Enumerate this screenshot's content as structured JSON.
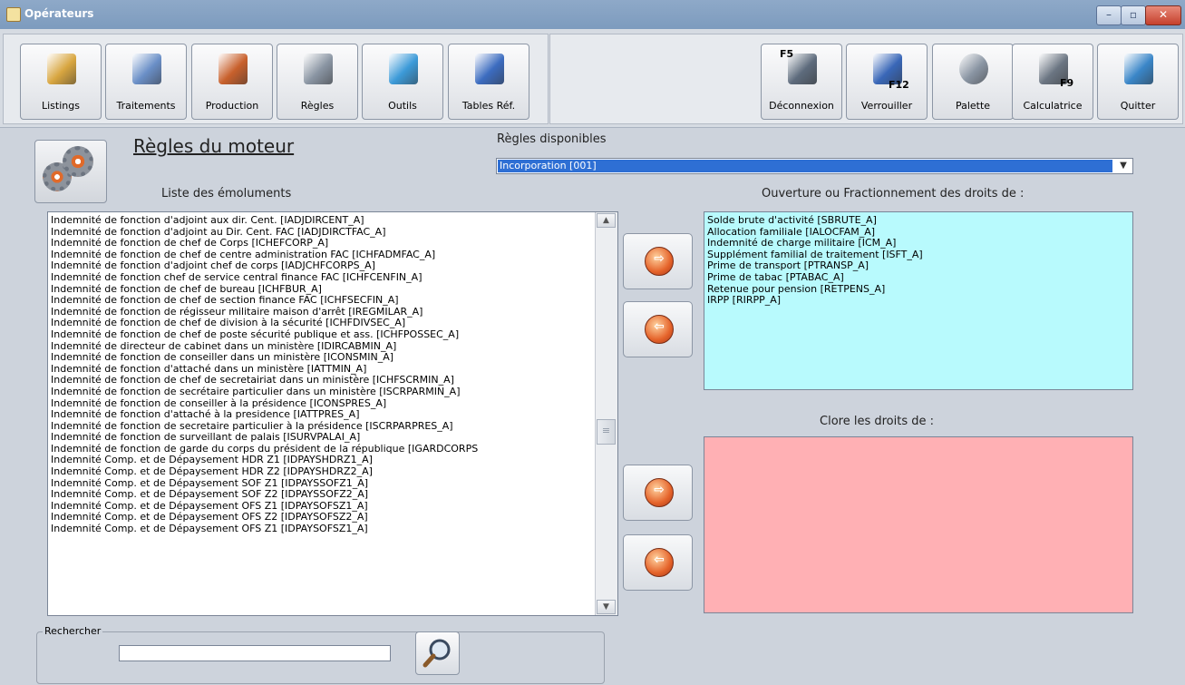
{
  "window": {
    "title": "Opérateurs",
    "controls": [
      "–",
      "▫",
      "✕"
    ]
  },
  "toolbar": {
    "left_buttons": [
      {
        "label": "Listings",
        "icon": "magnifier-report-icon",
        "color": "#d8a640"
      },
      {
        "label": "Traitements",
        "icon": "processing-icon",
        "color": "#6a8fc7"
      },
      {
        "label": "Production",
        "icon": "books-icon",
        "color": "#c8602c"
      },
      {
        "label": "Règles",
        "icon": "gears-icon",
        "color": "#8a95a3"
      },
      {
        "label": "Outils",
        "icon": "toolbox-icon",
        "color": "#3c9ad8"
      },
      {
        "label": "Tables Réf.",
        "icon": "tables-icon",
        "color": "#3c6cc0"
      }
    ],
    "right_buttons": [
      {
        "label": "Déconnexion",
        "icon": "disconnect-icon",
        "key": "F5",
        "color": "#5d6b7c"
      },
      {
        "label": "Verrouiller",
        "icon": "lock-screen-icon",
        "key": "F12",
        "color": "#3967b8"
      },
      {
        "label": "Palette",
        "icon": "palette-icon",
        "key": "",
        "color": "#8a95a3"
      },
      {
        "label": "Calculatrice",
        "icon": "calculator-icon",
        "key": "F9",
        "color": "#6b7582"
      },
      {
        "label": "Quitter",
        "icon": "exit-icon",
        "key": "",
        "color": "#3a86c8"
      }
    ]
  },
  "main": {
    "heading": "Règles du moteur",
    "rules_label": "Règles disponibles",
    "rules_selected": "Incorporation [001]",
    "emoluments_label": "Liste des émoluments",
    "emoluments": [
      "Indemnité de fonction d'adjoint aux dir. Cent. [IADJDIRCENT_A]",
      "Indemnité de fonction d'adjoint au Dir. Cent. FAC [IADJDIRCTFAC_A]",
      "Indemnité de fonction de chef de Corps [ICHEFCORP_A]",
      "Indemnité de fonction de chef de centre administration FAC [ICHFADMFAC_A]",
      "Indemnité de fonction d'adjoint chef de corps [IADJCHFCORPS_A]",
      "Indemnité de fonction chef de service central finance FAC [ICHFCENFIN_A]",
      "Indemnité de fonction de chef de bureau [ICHFBUR_A]",
      "Indemnité de fonction de chef de section finance FAC [ICHFSECFIN_A]",
      "Indemnité de fonction de régisseur militaire maison d'arrêt [IREGMILAR_A]",
      "Indemnité de fonction de chef de division à la sécurité [ICHFDIVSEC_A]",
      "Indemnité de fonction de chef de poste sécurité publique et ass. [ICHFPOSSEC_A]",
      "Indemnité de directeur de cabinet dans un ministère [IDIRCABMIN_A]",
      "Indemnité de fonction de conseiller dans un ministère [ICONSMIN_A]",
      "Indemnité de fonction d'attaché dans un ministère [IATTMIN_A]",
      "Indemnité de fonction de chef de secretairiat dans un ministère [ICHFSCRMIN_A]",
      "Indemnité de fonction de secrétaire particulier dans un ministère [ISCRPARMIN_A]",
      "Indemnité de fonction de conseiller à la présidence [ICONSPRES_A]",
      "Indemnité de fonction d'attaché à la presidence [IATTPRES_A]",
      "Indemnité de fonction de secretaire particulier à la présidence [ISCRPARPRES_A]",
      "Indemnité de fonction de surveillant de palais [ISURVPALAI_A]",
      "Indemnité de fonction de garde du corps du président de la république [IGARDCORPS",
      "Indemnité Comp. et de Dépaysement HDR Z1 [IDPAYSHDRZ1_A]",
      "Indemnité Comp. et de Dépaysement HDR Z2 [IDPAYSHDRZ2_A]",
      "Indemnité Comp. et de Dépaysement SOF Z1 [IDPAYSSOFZ1_A]",
      "Indemnité Comp. et de Dépaysement SOF Z2 [IDPAYSSOFZ2_A]",
      "Indemnité Comp. et de Dépaysement OFS Z1 [IDPAYSOFSZ1_A]",
      "Indemnité Comp. et de Dépaysement OFS Z2 [IDPAYSOFSZ2_A]",
      "Indemnité Comp. et de Dépaysement OFS Z1 [IDPAYSOFSZ1_A]"
    ],
    "scroll": {
      "up": "▲",
      "down": "▼",
      "grip": "≡"
    },
    "arrows": {
      "right": "⇨",
      "left": "⇦"
    },
    "open_label": "Ouverture ou Fractionnement des droits de :",
    "open_items": [
      "Solde brute d'activité [SBRUTE_A]",
      "Allocation familiale [IALOCFAM_A]",
      "Indemnité de charge militaire [ICM_A]",
      "Supplément familial de traitement [ISFT_A]",
      "Prime de transport [PTRANSP_A]",
      "Prime de tabac [PTABAC_A]",
      "Retenue pour pension [RETPENS_A]",
      "IRPP [RIRPP_A]"
    ],
    "open_color": "#b8fafd",
    "close_label": "Clore les droits de :",
    "close_items": [],
    "close_color": "#ffb0b4",
    "search_legend": "Rechercher",
    "search_value": ""
  }
}
